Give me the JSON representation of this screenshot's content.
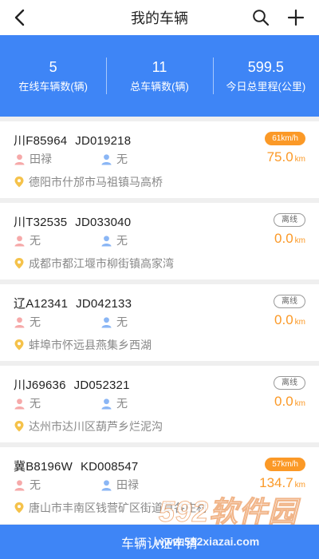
{
  "header": {
    "title": "我的车辆"
  },
  "stats": [
    {
      "value": "5",
      "label": "在线车辆数(辆)"
    },
    {
      "value": "11",
      "label": "总车辆数(辆)"
    },
    {
      "value": "599.5",
      "label": "今日总里程(公里)"
    }
  ],
  "vehicles": [
    {
      "plate": "川F85964",
      "device": "JD019218",
      "status": "61km/h",
      "online": true,
      "driver1": "田禄",
      "driver2": "无",
      "mileage": "75.0",
      "unit": "km",
      "address": "德阳市什邡市马祖镇马高桥"
    },
    {
      "plate": "川T32535",
      "device": "JD033040",
      "status": "离线",
      "online": false,
      "driver1": "无",
      "driver2": "无",
      "mileage": "0.0",
      "unit": "km",
      "address": "成都市都江堰市柳街镇高家湾"
    },
    {
      "plate": "辽A12341",
      "device": "JD042133",
      "status": "离线",
      "online": false,
      "driver1": "无",
      "driver2": "无",
      "mileage": "0.0",
      "unit": "km",
      "address": "蚌埠市怀远县燕集乡西湖"
    },
    {
      "plate": "川J69636",
      "device": "JD052321",
      "status": "离线",
      "online": false,
      "driver1": "无",
      "driver2": "无",
      "mileage": "0.0",
      "unit": "km",
      "address": "达州市达川区葫芦乡烂泥沟"
    },
    {
      "plate": "冀B8196W",
      "device": "KD008547",
      "status": "57km/h",
      "online": true,
      "driver1": "无",
      "driver2": "田禄",
      "mileage": "134.7",
      "unit": "km",
      "address": "唐山市丰南区钱营矿区街道草各庄村"
    }
  ],
  "footer": {
    "button_label": "车辆认证申请"
  },
  "watermark": {
    "logo_text": "592软件园",
    "url": "www.592xiazai.com"
  },
  "colors": {
    "primary": "#3e85f6",
    "accent": "#fb9927"
  },
  "icons": {
    "back": "chevron-left-icon",
    "search": "search-icon",
    "add": "plus-icon",
    "driver1": "person-pink-icon",
    "driver2": "person-blue-icon",
    "location": "location-pin-icon"
  }
}
